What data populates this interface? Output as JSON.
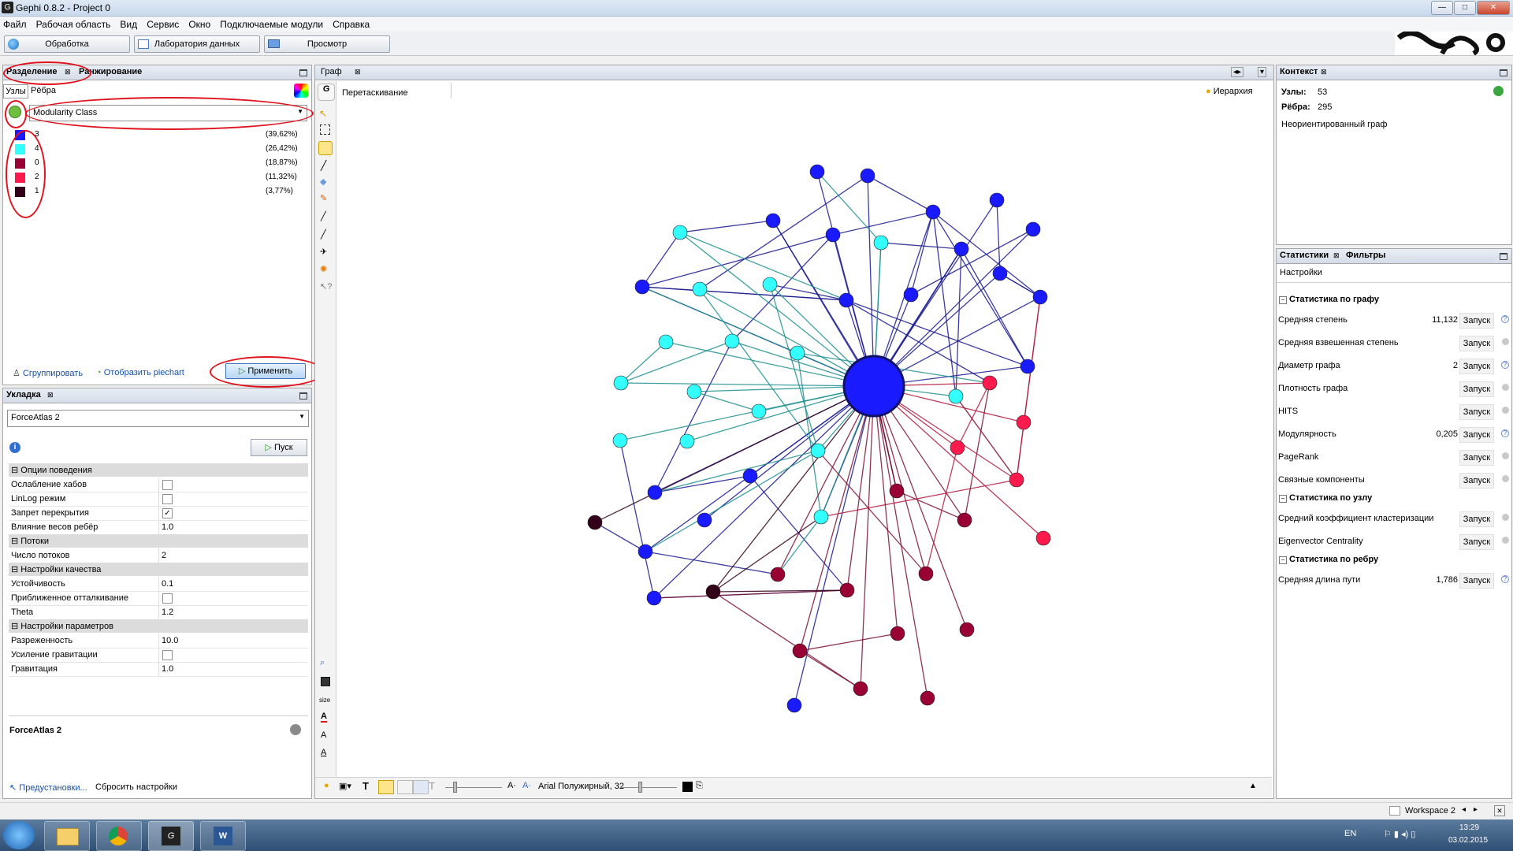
{
  "window": {
    "title": "Gephi 0.8.2 - Project 0"
  },
  "menu": [
    "Файл",
    "Рабочая область",
    "Вид",
    "Сервис",
    "Окно",
    "Подключаемые модули",
    "Справка"
  ],
  "modes": {
    "overview": "Обработка",
    "data_lab": "Лаборатория данных",
    "preview": "Просмотр"
  },
  "partition": {
    "tab_partition": "Разделение",
    "tab_ranking": "Ранжирование",
    "subtab_nodes": "Узлы",
    "subtab_edges": "Рёбра",
    "dropdown": "Modularity Class",
    "legend": [
      {
        "id": "3",
        "pct": "(39,62%)",
        "color": "#1a1aff"
      },
      {
        "id": "4",
        "pct": "(26,42%)",
        "color": "#33ffff"
      },
      {
        "id": "0",
        "pct": "(18,87%)",
        "color": "#990033"
      },
      {
        "id": "2",
        "pct": "(11,32%)",
        "color": "#ff1a4d"
      },
      {
        "id": "1",
        "pct": "(3,77%)",
        "color": "#33001a"
      }
    ],
    "group_label": "Сгруппировать",
    "piechart_label": "Отобразить piechart",
    "apply_label": "Применить"
  },
  "layout": {
    "tab": "Укладка",
    "algorithm": "ForceAtlas 2",
    "run_label": "Пуск",
    "categories": [
      {
        "name": "Опции поведения",
        "rows": [
          {
            "k": "Ослабление хабов",
            "v": "",
            "check": false
          },
          {
            "k": "LinLog режим",
            "v": "",
            "check": false
          },
          {
            "k": "Запрет перекрытия",
            "v": "",
            "check": true
          },
          {
            "k": "Влияние весов ребёр",
            "v": "1.0"
          }
        ]
      },
      {
        "name": "Потоки",
        "rows": [
          {
            "k": "Число потоков",
            "v": "2"
          }
        ]
      },
      {
        "name": "Настройки качества",
        "rows": [
          {
            "k": "Устойчивость",
            "v": "0.1"
          },
          {
            "k": "Приближенное отталкивание",
            "v": "",
            "check": false
          },
          {
            "k": "Theta",
            "v": "1.2"
          }
        ]
      },
      {
        "name": "Настройки параметров",
        "rows": [
          {
            "k": "Разреженность",
            "v": "10.0"
          },
          {
            "k": "Усиление гравитации",
            "v": "",
            "check": false
          },
          {
            "k": "Гравитация",
            "v": "1.0"
          }
        ]
      }
    ],
    "desc_title": "ForceAtlas 2",
    "presets": "Предустановки...",
    "reset": "Сбросить настройки"
  },
  "graph": {
    "tab": "Граф",
    "drag_label": "Перетаскивание",
    "hierarchy_label": "Иерархия",
    "size_label": "size",
    "font_label": "Arial Полужирный, 32"
  },
  "context": {
    "tab": "Контекст",
    "nodes_label": "Узлы:",
    "nodes_value": "53",
    "edges_label": "Рёбра:",
    "edges_value": "295",
    "graph_type": "Неориентированный граф"
  },
  "statistics": {
    "tab_stats": "Статистики",
    "tab_filters": "Фильтры",
    "settings": "Настройки",
    "run": "Запуск",
    "graph_cat": "Статистика по графу",
    "node_cat": "Статистика по узлу",
    "edge_cat": "Статистика по ребру",
    "graph_rows": [
      {
        "k": "Средняя степень",
        "v": "11,132",
        "q": true
      },
      {
        "k": "Средняя взвешенная степень",
        "v": "",
        "q": false
      },
      {
        "k": "Диаметр графа",
        "v": "2",
        "q": true
      },
      {
        "k": "Плотность графа",
        "v": "",
        "q": false
      },
      {
        "k": "HITS",
        "v": "",
        "q": false
      },
      {
        "k": "Модулярность",
        "v": "0,205",
        "q": true
      },
      {
        "k": "PageRank",
        "v": "",
        "q": false
      },
      {
        "k": "Связные компоненты",
        "v": "",
        "q": false
      }
    ],
    "node_rows": [
      {
        "k": "Средний коэффициент кластеризации",
        "v": "",
        "q": false
      },
      {
        "k": "Eigenvector Centrality",
        "v": "",
        "q": false
      }
    ],
    "edge_rows": [
      {
        "k": "Средняя длина пути",
        "v": "1,786",
        "q": true
      }
    ]
  },
  "status": {
    "workspace": "Workspace 2"
  },
  "taskbar": {
    "lang": "EN",
    "time": "13:29",
    "date": "03.02.2015"
  }
}
